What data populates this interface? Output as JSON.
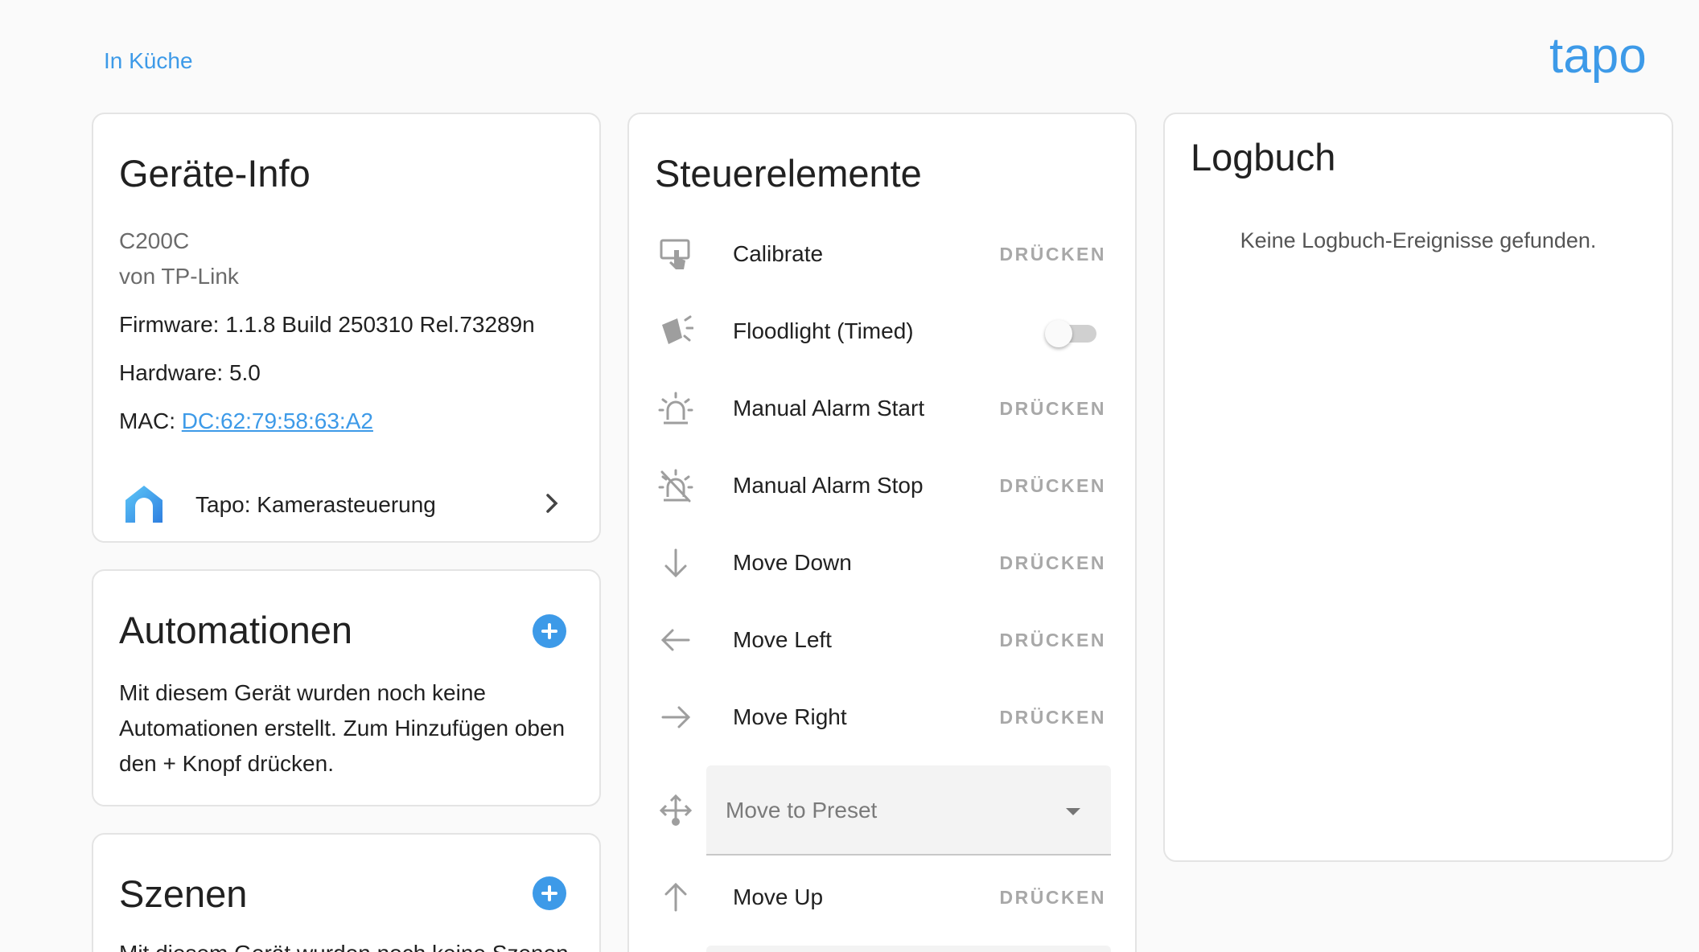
{
  "breadcrumb": "In Küche",
  "brand": {
    "name": "tapo",
    "color": "#3d9ae8"
  },
  "device_info": {
    "title": "Geräte-Info",
    "model": "C200C",
    "manufacturer": "von TP-Link",
    "firmware": "Firmware: 1.1.8 Build 250310 Rel.73289n",
    "hardware": "Hardware: 5.0",
    "mac_label": "MAC: ",
    "mac_value": "DC:62:79:58:63:A2",
    "integration": {
      "label": "Tapo: Kamerasteuerung",
      "icon": "tapo-home-logo"
    }
  },
  "automations": {
    "title": "Automationen",
    "empty_text": "Mit diesem Gerät wurden noch keine Automationen erstellt. Zum Hinzufügen oben den + Knopf drücken."
  },
  "scenes": {
    "title": "Szenen",
    "empty_text": "Mit diesem Gerät wurden noch keine Szenen"
  },
  "controls": {
    "title": "Steuerelemente",
    "press_label": "DRÜCKEN",
    "items": [
      {
        "label": "Calibrate",
        "icon": "gesture-tap-icon",
        "type": "button"
      },
      {
        "label": "Floodlight (Timed)",
        "icon": "flashlight-icon",
        "type": "toggle",
        "state": "off"
      },
      {
        "label": "Manual Alarm Start",
        "icon": "alarm-light-icon",
        "type": "button"
      },
      {
        "label": "Manual Alarm Stop",
        "icon": "alarm-light-off-icon",
        "type": "button"
      },
      {
        "label": "Move Down",
        "icon": "arrow-down-icon",
        "type": "button"
      },
      {
        "label": "Move Left",
        "icon": "arrow-left-icon",
        "type": "button"
      },
      {
        "label": "Move Right",
        "icon": "arrow-right-icon",
        "type": "button"
      },
      {
        "label": "Move to Preset",
        "icon": "move-preset-icon",
        "type": "select"
      },
      {
        "label": "Move Up",
        "icon": "arrow-up-icon",
        "type": "button"
      }
    ]
  },
  "logbook": {
    "title": "Logbuch",
    "empty_text": "Keine Logbuch-Ereignisse gefunden."
  }
}
